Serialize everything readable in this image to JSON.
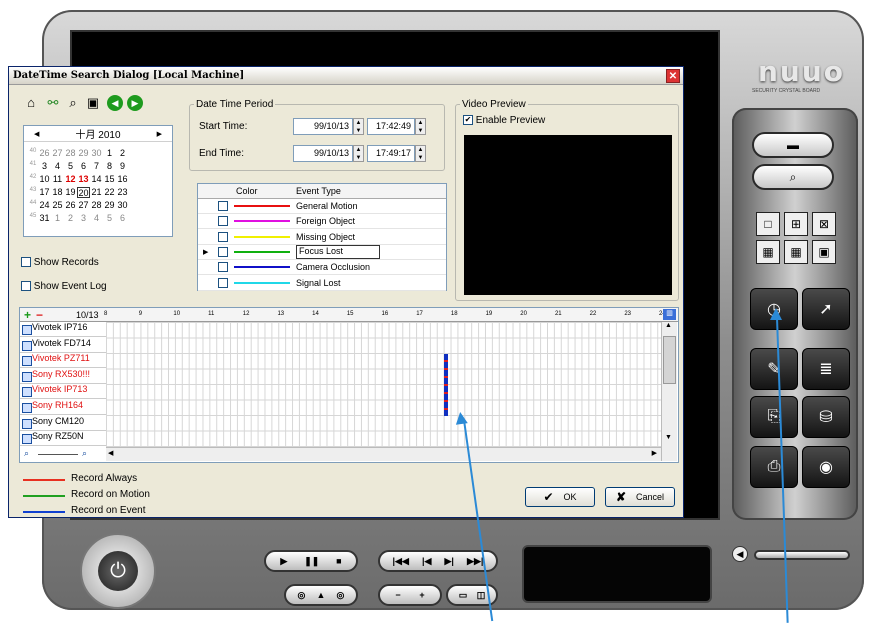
{
  "app": {
    "logo": "nuuo",
    "logo_subtitle": "SECURITY CRYSTAL BOARD",
    "right_panel_icons": [
      "folder-icon",
      "search-recording-icon",
      "layout-1x1-icon",
      "layout-2x2-icon",
      "layout-fullscreen-icon",
      "layout-3x3-icon",
      "layout-4x4-icon",
      "layout-pip-icon",
      "datetime-search-icon",
      "setup-icon",
      "edit-icon",
      "note-icon",
      "export-icon",
      "backup-icon",
      "print-icon",
      "eye-icon"
    ],
    "bottom_controls": {
      "play": "▶",
      "pause": "❚❚",
      "stop": "■",
      "first": "|◀◀",
      "prev": "|◀",
      "next": "▶|",
      "last": "▶▶|",
      "speed_down": "−",
      "speed_up": "+"
    }
  },
  "dialog": {
    "title": "DateTime Search Dialog  [Local Machine]",
    "close": "✕",
    "calendar": {
      "month_label": "十月 2010",
      "prev": "◀",
      "next": "▶",
      "rows": [
        {
          "wk": "40",
          "days": [
            [
              "26",
              "g"
            ],
            [
              "27",
              "g"
            ],
            [
              "28",
              "g"
            ],
            [
              "29",
              "g"
            ],
            [
              "30",
              "g"
            ],
            [
              "1",
              ""
            ],
            [
              "2",
              ""
            ]
          ]
        },
        {
          "wk": "41",
          "days": [
            [
              "3",
              ""
            ],
            [
              "4",
              ""
            ],
            [
              "5",
              ""
            ],
            [
              "6",
              ""
            ],
            [
              "7",
              ""
            ],
            [
              "8",
              ""
            ],
            [
              "9",
              ""
            ]
          ]
        },
        {
          "wk": "42",
          "days": [
            [
              "10",
              ""
            ],
            [
              "11",
              ""
            ],
            [
              "12",
              "r"
            ],
            [
              "13",
              "r"
            ],
            [
              "14",
              ""
            ],
            [
              "15",
              ""
            ],
            [
              "16",
              ""
            ]
          ]
        },
        {
          "wk": "43",
          "days": [
            [
              "17",
              ""
            ],
            [
              "18",
              ""
            ],
            [
              "19",
              ""
            ],
            [
              "20",
              "s"
            ],
            [
              "21",
              ""
            ],
            [
              "22",
              ""
            ],
            [
              "23",
              ""
            ]
          ]
        },
        {
          "wk": "44",
          "days": [
            [
              "24",
              ""
            ],
            [
              "25",
              ""
            ],
            [
              "26",
              ""
            ],
            [
              "27",
              ""
            ],
            [
              "28",
              ""
            ],
            [
              "29",
              ""
            ],
            [
              "30",
              ""
            ]
          ]
        },
        {
          "wk": "45",
          "days": [
            [
              "31",
              ""
            ],
            [
              "1",
              "g"
            ],
            [
              "2",
              "g"
            ],
            [
              "3",
              "g"
            ],
            [
              "4",
              "g"
            ],
            [
              "5",
              "g"
            ],
            [
              "6",
              "g"
            ]
          ]
        }
      ]
    },
    "show_records": "Show Records",
    "show_event_log": "Show Event Log",
    "period": {
      "legend": "Date Time Period",
      "start_label": "Start Time:",
      "start_date": "99/10/13",
      "start_time": "17:42:49",
      "end_label": "End Time:",
      "end_date": "99/10/13",
      "end_time": "17:49:17"
    },
    "event_table": {
      "col_color": "Color",
      "col_type": "Event Type",
      "rows": [
        {
          "color": "#e81010",
          "type": "General Motion"
        },
        {
          "color": "#e010e0",
          "type": "Foreign Object"
        },
        {
          "color": "#f0f000",
          "type": "Missing Object"
        },
        {
          "color": "#10b010",
          "type": "Focus Lost"
        },
        {
          "color": "#1010c8",
          "type": "Camera Occlusion"
        },
        {
          "color": "#20d8e8",
          "type": "Signal Lost"
        }
      ]
    },
    "preview": {
      "legend": "Video Preview",
      "enable_label": "Enable Preview",
      "enabled": true
    },
    "timeline": {
      "date_label": "10/13",
      "hours": [
        "8",
        "9",
        "10",
        "11",
        "12",
        "13",
        "14",
        "15",
        "16",
        "17",
        "18",
        "19",
        "20",
        "21",
        "22",
        "23",
        "24"
      ],
      "cameras": [
        {
          "name": "Vivotek IP716",
          "red": false
        },
        {
          "name": "Vivotek FD714",
          "red": false
        },
        {
          "name": "Vivotek PZ711",
          "red": true
        },
        {
          "name": "Sony RX530!!!",
          "red": true
        },
        {
          "name": "Vivotek IP713",
          "red": true
        },
        {
          "name": "Sony RH164",
          "red": true
        },
        {
          "name": "Sony CM120",
          "red": false
        },
        {
          "name": "Sony RZ50N",
          "red": false
        }
      ],
      "record_hour": 17.75
    },
    "legend_items": [
      {
        "color": "#e83020",
        "label": "Record Always"
      },
      {
        "color": "#20a020",
        "label": "Record on Motion"
      },
      {
        "color": "#1040d0",
        "label": "Record on Event"
      }
    ],
    "ok": "OK",
    "cancel": "Cancel"
  }
}
